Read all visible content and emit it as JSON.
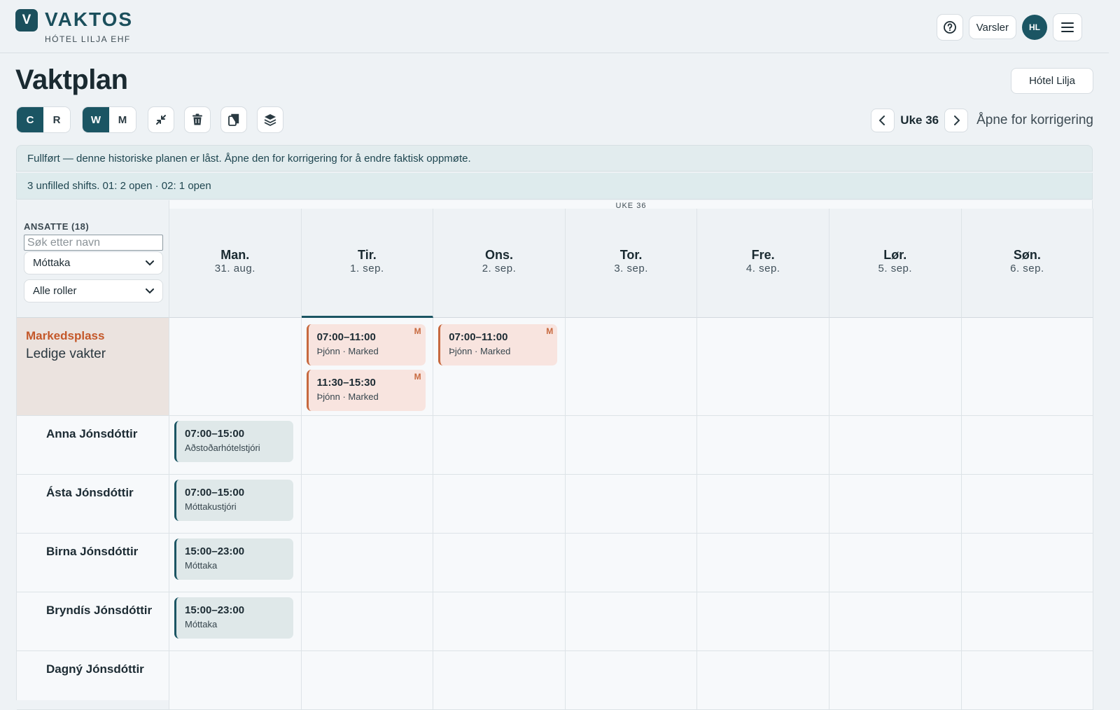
{
  "brand": {
    "initial": "V",
    "name": "VAKTOS",
    "subtitle": "HÓTEL LILJA EHF"
  },
  "header": {
    "alerts_label": "Varsler",
    "avatar_initials": "HL"
  },
  "page": {
    "title": "Vaktplan",
    "hotel": "Hótel Lilja"
  },
  "toolbar": {
    "view_mode": [
      "C",
      "R"
    ],
    "range_mode": [
      "W",
      "M"
    ]
  },
  "week_nav": {
    "label": "Uke 36",
    "reopen_label": "Åpne for korrigering"
  },
  "banners": {
    "completed": "Fullført — denne historiske planen er låst. Åpne den for korrigering for å endre faktisk oppmøte.",
    "unfilled": "3 unfilled shifts. 01: 2 open · 02: 1 open"
  },
  "grid": {
    "week_caption": "UKE 36",
    "staff_header": "ANSATTE (18)",
    "search_placeholder": "Søk etter navn",
    "department": "Móttaka",
    "role_filter": "Alle roller",
    "days": [
      {
        "name": "Man.",
        "date": "31. aug."
      },
      {
        "name": "Tir.",
        "date": "1. sep."
      },
      {
        "name": "Ons.",
        "date": "2. sep."
      },
      {
        "name": "Tor.",
        "date": "3. sep."
      },
      {
        "name": "Fre.",
        "date": "4. sep."
      },
      {
        "name": "Lør.",
        "date": "5. sep."
      },
      {
        "name": "Søn.",
        "date": "6. sep."
      }
    ],
    "market": {
      "title": "Markedsplass",
      "subtitle": "Ledige vakter",
      "shifts": [
        {
          "time": "07:00–11:00",
          "role": "Þjónn · Marked",
          "badge": "M"
        },
        {
          "time": "11:30–15:30",
          "role": "Þjónn · Marked",
          "badge": "M"
        },
        {
          "time": "07:00–11:00",
          "role": "Þjónn · Marked",
          "badge": "M"
        }
      ]
    },
    "employees": [
      {
        "name": "Anna Jónsdóttir",
        "shift_time": "07:00–15:00",
        "shift_role": "Aðstoðarhótelstjóri"
      },
      {
        "name": "Ásta Jónsdóttir",
        "shift_time": "07:00–15:00",
        "shift_role": "Móttakustjóri"
      },
      {
        "name": "Birna Jónsdóttir",
        "shift_time": "15:00–23:00",
        "shift_role": "Móttaka"
      },
      {
        "name": "Bryndís Jónsdóttir",
        "shift_time": "15:00–23:00",
        "shift_role": "Móttaka"
      },
      {
        "name": "Dagný Jónsdóttir"
      }
    ]
  }
}
